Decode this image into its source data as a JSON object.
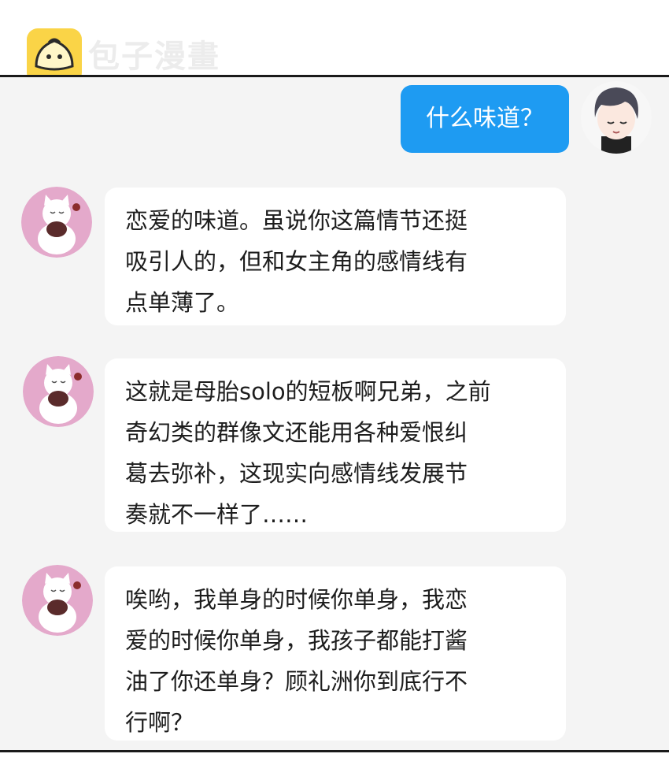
{
  "header": {
    "brand_name": "包子漫畫",
    "brand_icon": "bun-logo-icon",
    "brand_color": "#fad447"
  },
  "chat": {
    "outgoing": {
      "text": "什么味道？",
      "avatar": "boy-avatar",
      "bubble_color": "#1e9bf2"
    },
    "incoming": [
      {
        "avatar": "cat-avatar",
        "text": "恋爱的味道。虽说你这篇情节还挺\n吸引人的，但和女主角的感情线有\n点单薄了。"
      },
      {
        "avatar": "cat-avatar",
        "text": "这就是母胎solo的短板啊兄弟，之前\n奇幻类的群像文还能用各种爱恨纠\n葛去弥补，这现实向感情线发展节\n奏就不一样了……"
      },
      {
        "avatar": "cat-avatar",
        "text": "唉哟，我单身的时候你单身，我恋\n爱的时候你单身，我孩子都能打酱\n油了你还单身？顾礼洲你到底行不\n行啊？"
      }
    ],
    "panel_background": "#f4f4f4"
  }
}
